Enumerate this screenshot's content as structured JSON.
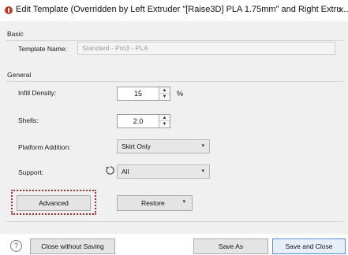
{
  "window": {
    "title": "Edit Template (Overridden by Left Extruder \"[Raise3D] PLA 1.75mm\" and Right Extru...",
    "close_glyph": "×",
    "title_icon": "alert-circle-icon"
  },
  "basic": {
    "section_label": "Basic",
    "template_name_label": "Template Name:",
    "template_name_value": "Standard - Pro3 - PLA"
  },
  "general": {
    "section_label": "General",
    "infill_density": {
      "label": "Infill Density:",
      "value": "15",
      "unit": "%"
    },
    "shells": {
      "label": "Shells:",
      "value": "2.0"
    },
    "platform_addition": {
      "label": "Platform Addition:",
      "selected": "Skirt Only"
    },
    "support": {
      "label": "Support:",
      "selected": "All",
      "reset_icon": "reset-icon"
    }
  },
  "actions": {
    "advanced_label": "Advanced",
    "restore_label": "Restore",
    "highlight_color": "#b52a2a"
  },
  "footer": {
    "help_glyph": "?",
    "close_without_saving_label": "Close without Saving",
    "save_as_label": "Save As",
    "save_and_close_label": "Save and Close"
  },
  "spin_glyphs": {
    "up": "▲",
    "down": "▼"
  },
  "combo_glyph": "▾"
}
